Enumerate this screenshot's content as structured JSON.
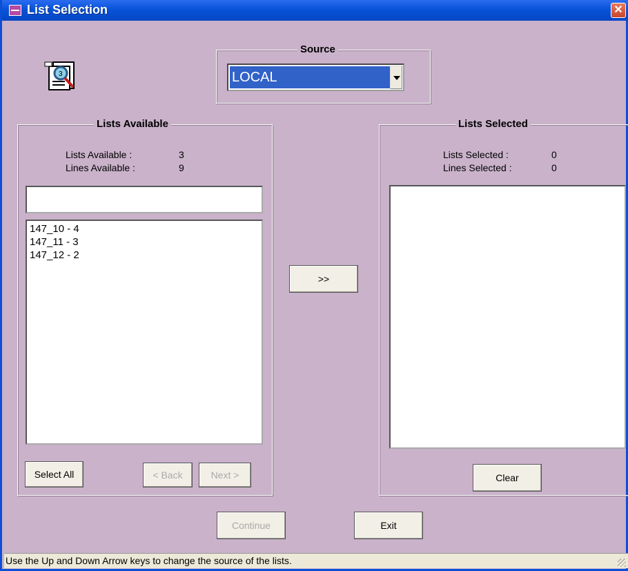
{
  "window": {
    "title": "List Selection",
    "close_symbol": "✕",
    "accent": "#0753d8",
    "background": "#c9b2ca"
  },
  "app_icon": {
    "icon": "list-search-icon"
  },
  "source": {
    "legend": "Source",
    "value": "LOCAL"
  },
  "available": {
    "legend": "Lists Available",
    "lists_label": "Lists Available :",
    "lists_value": "3",
    "lines_label": "Lines Available  :",
    "lines_value": "9",
    "filter_value": "",
    "items": [
      "147_10 - 4",
      "147_11 - 3",
      "147_12 - 2"
    ],
    "select_all": "Select All",
    "back": "< Back",
    "next": "Next >"
  },
  "transfer": {
    "label": ">>"
  },
  "selected": {
    "legend": "Lists Selected",
    "lists_label": "Lists Selected :",
    "lists_value": "0",
    "lines_label": "Lines Selected  :",
    "lines_value": "0",
    "clear": "Clear"
  },
  "footer": {
    "continue": "Continue",
    "exit": "Exit"
  },
  "status": {
    "text": "Use the Up and Down Arrow keys to change the source of the lists."
  }
}
